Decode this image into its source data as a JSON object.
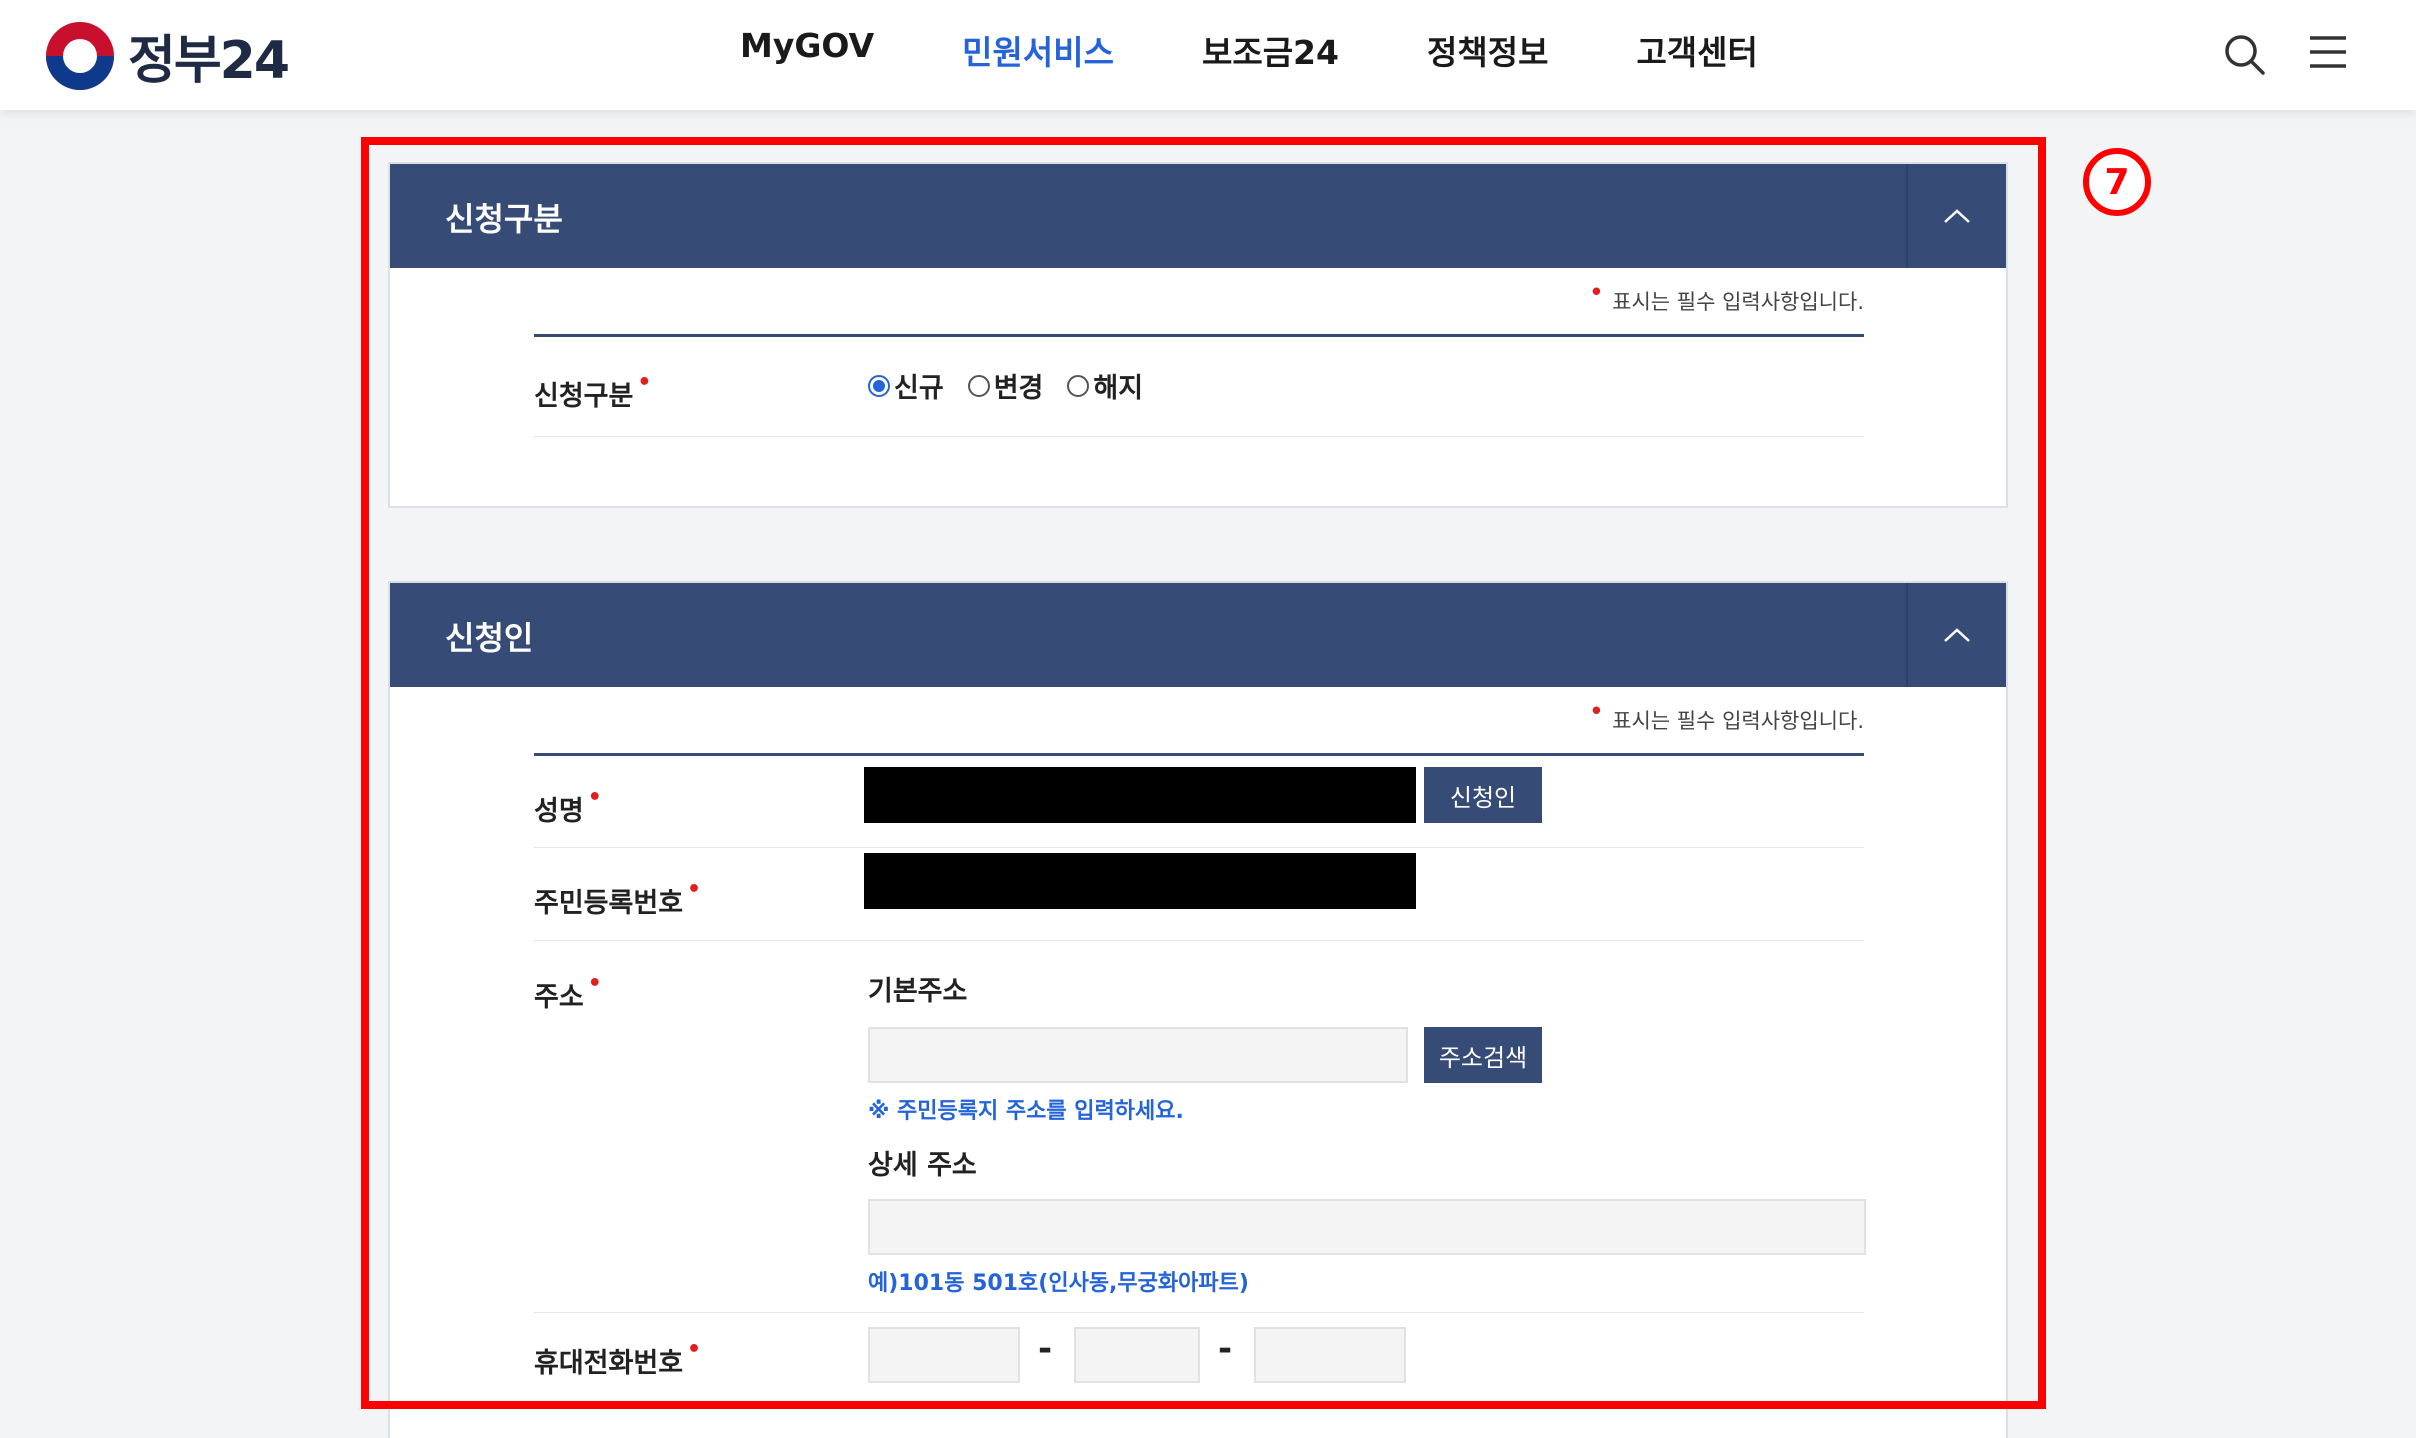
{
  "header": {
    "logo_text": "정부24",
    "nav": [
      {
        "label": "MyGOV",
        "active": false
      },
      {
        "label": "민원서비스",
        "active": true
      },
      {
        "label": "보조금24",
        "active": false
      },
      {
        "label": "정책정보",
        "active": false
      },
      {
        "label": "고객센터",
        "active": false
      }
    ],
    "icons": {
      "search": "search-icon",
      "menu": "hamburger-menu-icon"
    }
  },
  "annotation": {
    "step_number": "7",
    "color": "#ff0000"
  },
  "section_application_type": {
    "title": "신청구분",
    "required_note": "표시는 필수 입력사항입니다.",
    "field_label": "신청구분",
    "options": [
      {
        "label": "신규",
        "checked": true
      },
      {
        "label": "변경",
        "checked": false
      },
      {
        "label": "해지",
        "checked": false
      }
    ]
  },
  "section_applicant": {
    "title": "신청인",
    "required_note": "표시는 필수 입력사항입니다.",
    "name": {
      "label": "성명",
      "button": "신청인"
    },
    "resident_number": {
      "label": "주민등록번호"
    },
    "address": {
      "label": "주소",
      "basic_label": "기본주소",
      "search_button": "주소검색",
      "basic_hint": "※ 주민등록지 주소를 입력하세요.",
      "detail_label": "상세 주소",
      "detail_hint": "예)101동 501호(인사동,무궁화아파트)"
    },
    "mobile": {
      "label": "휴대전화번호",
      "separator": "-"
    }
  },
  "colors": {
    "section_header": "#364b76",
    "accent_blue": "#2464d8",
    "required_dot": "#e02020"
  }
}
